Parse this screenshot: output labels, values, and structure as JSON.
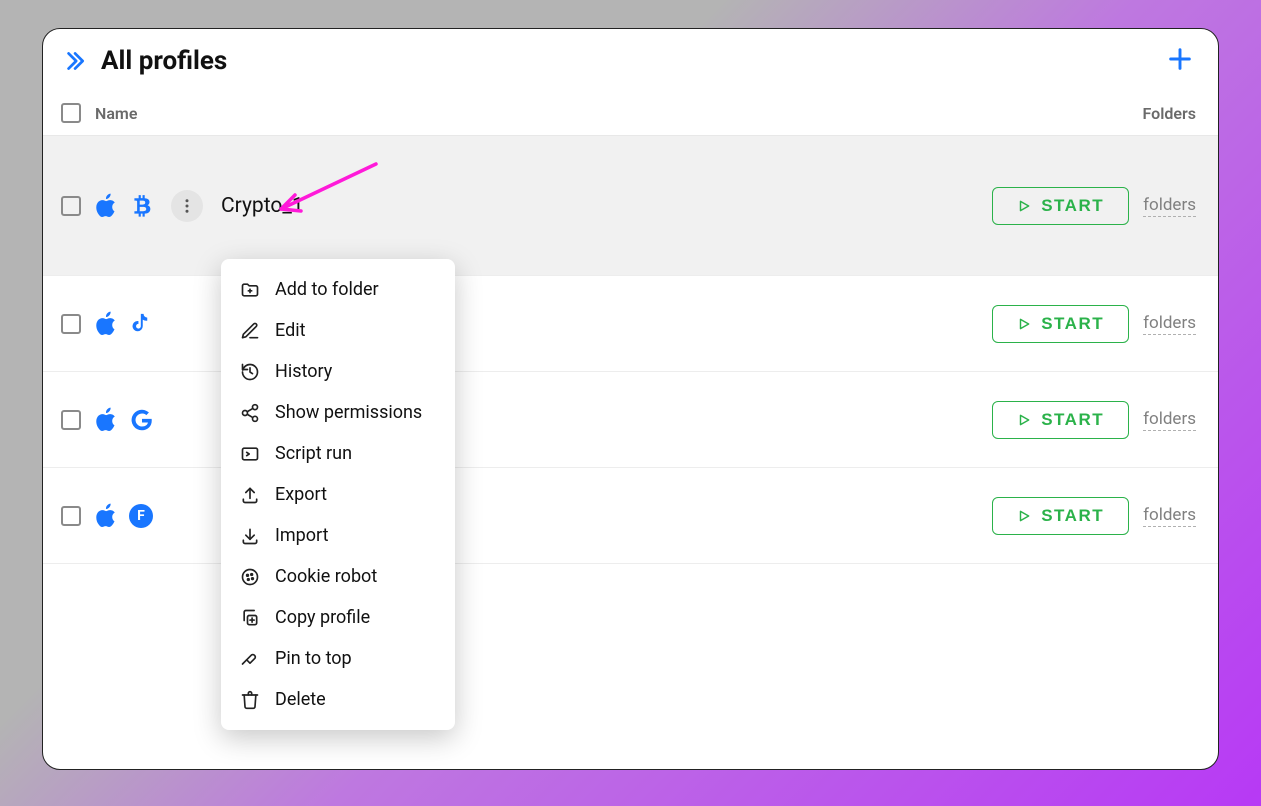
{
  "header": {
    "title": "All profiles"
  },
  "columns": {
    "name": "Name",
    "folders": "Folders"
  },
  "start_label": "START",
  "folders_label": "folders",
  "rows": [
    {
      "name": "Crypto_1",
      "circle_f": "F"
    }
  ],
  "menu": {
    "add_to_folder": "Add to folder",
    "edit": "Edit",
    "history": "History",
    "show_permissions": "Show permissions",
    "script_run": "Script run",
    "export": "Export",
    "import": "Import",
    "cookie_robot": "Cookie robot",
    "copy_profile": "Copy profile",
    "pin_to_top": "Pin to top",
    "delete": "Delete"
  }
}
